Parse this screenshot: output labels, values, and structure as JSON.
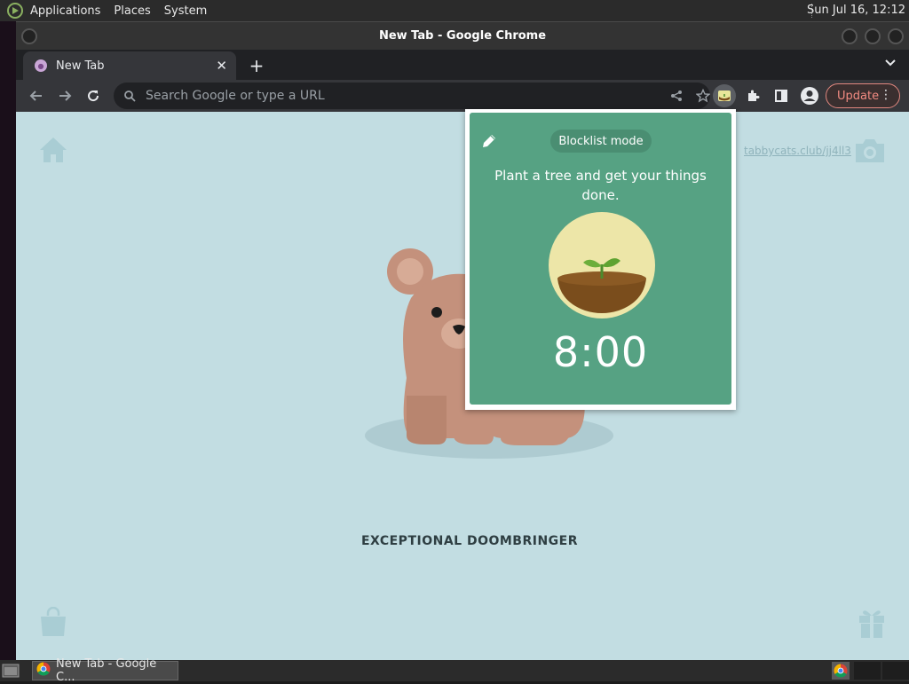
{
  "top_panel": {
    "menus": [
      "Applications",
      "Places",
      "System"
    ],
    "clock": "Sun Jul 16, 12:12"
  },
  "window": {
    "title": "New Tab - Google Chrome"
  },
  "tabs": [
    {
      "label": "New Tab"
    }
  ],
  "toolbar": {
    "omnibox_placeholder": "Search Google or type a URL",
    "update_label": "Update"
  },
  "page": {
    "photo_credit": "tabbycats.club/jj4ll3",
    "pet_name": "EXCEPTIONAL DOOMBRINGER"
  },
  "popup": {
    "mode_label": "Blocklist mode",
    "tagline": "Plant a tree and get your things done.",
    "timer": "8:00"
  },
  "taskbar": {
    "task_label": "New Tab - Google C..."
  },
  "colors": {
    "page_bg": "#c2dde2",
    "popup_green": "#56a283",
    "update_accent": "#f28b82"
  }
}
